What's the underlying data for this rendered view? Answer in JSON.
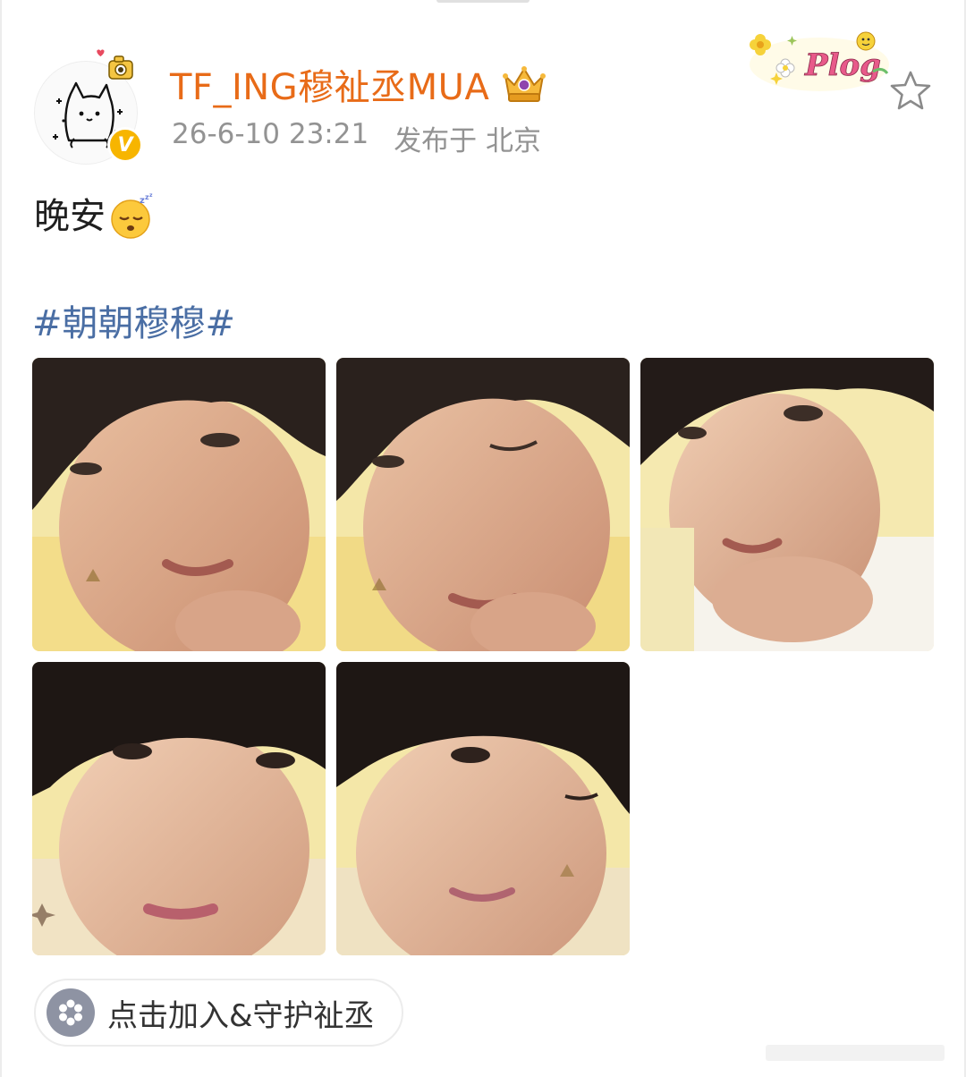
{
  "post": {
    "username": "TF_ING穆祉丞MUA",
    "date": "26-6-10 23:21",
    "location": "发布于 北京",
    "text": "晚安",
    "emoji": "sleeping-face-emoji",
    "hashtag": "#朝朝穆穆#",
    "photo_count": 5,
    "join_label": "点击加入&守护祉丞"
  },
  "icons": {
    "verified_badge": "V",
    "favorite": "star-outline-icon",
    "crown": "crown-badge-icon",
    "sticker": "plog-sticker"
  },
  "sticker_text": "Plog",
  "colors": {
    "username": "#e86b18",
    "hashtag": "#4a6ea4",
    "meta": "#939393",
    "verified": "#f7b500"
  }
}
